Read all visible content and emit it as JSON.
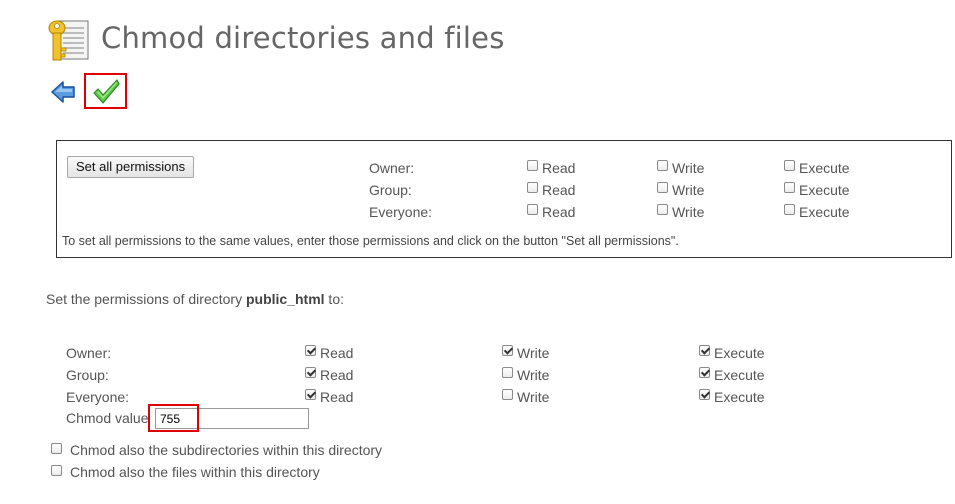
{
  "header": {
    "title": "Chmod directories and files",
    "title_icon": "key-document-icon",
    "back_icon": "back-arrow-icon",
    "submit_icon": "checkmark-icon"
  },
  "set_all": {
    "button_label": "Set all permissions",
    "rows": [
      {
        "label": "Owner:",
        "read": "Read",
        "write": "Write",
        "execute": "Execute",
        "read_checked": false,
        "write_checked": false,
        "execute_checked": false
      },
      {
        "label": "Group:",
        "read": "Read",
        "write": "Write",
        "execute": "Execute",
        "read_checked": false,
        "write_checked": false,
        "execute_checked": false
      },
      {
        "label": "Everyone:",
        "read": "Read",
        "write": "Write",
        "execute": "Execute",
        "read_checked": false,
        "write_checked": false,
        "execute_checked": false
      }
    ],
    "hint": "To set all permissions to the same values, enter those permissions and click on the button \"Set all permissions\"."
  },
  "directory": {
    "prefix": "Set the permissions of directory ",
    "name": "public_html",
    "suffix": " to:",
    "rows": [
      {
        "label": "Owner:",
        "read": "Read",
        "write": "Write",
        "execute": "Execute",
        "read_checked": true,
        "write_checked": true,
        "execute_checked": true
      },
      {
        "label": "Group:",
        "read": "Read",
        "write": "Write",
        "execute": "Execute",
        "read_checked": true,
        "write_checked": false,
        "execute_checked": true
      },
      {
        "label": "Everyone:",
        "read": "Read",
        "write": "Write",
        "execute": "Execute",
        "read_checked": true,
        "write_checked": false,
        "execute_checked": true
      }
    ],
    "chmod_label": "Chmod value",
    "chmod_value": "755",
    "options": [
      {
        "label": "Chmod also the subdirectories within this directory",
        "checked": false
      },
      {
        "label": "Chmod also the files within this directory",
        "checked": false
      }
    ]
  },
  "colors": {
    "highlight": "#e00000",
    "text": "#555555"
  }
}
